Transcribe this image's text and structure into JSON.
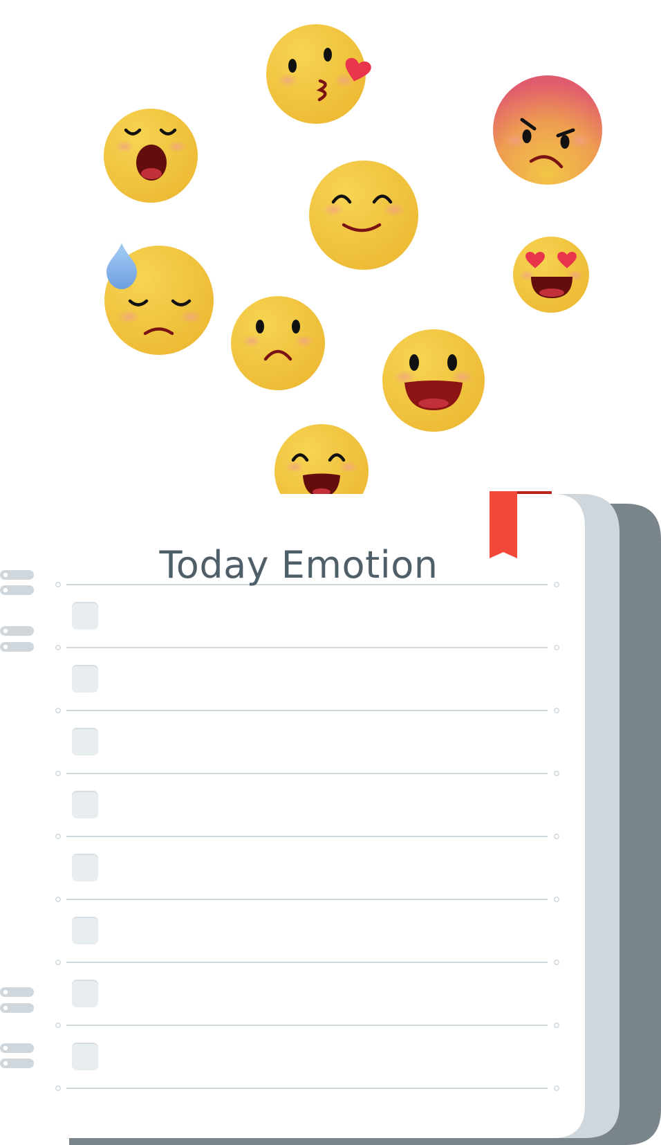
{
  "notebook": {
    "title": "Today Emotion",
    "checkbox_rows": 8,
    "checked": [
      false,
      false,
      false,
      false,
      false,
      false,
      false,
      false
    ]
  },
  "emojis": [
    {
      "name": "kissing-heart"
    },
    {
      "name": "angry"
    },
    {
      "name": "yawning"
    },
    {
      "name": "smiling"
    },
    {
      "name": "heart-eyes"
    },
    {
      "name": "downcast-sweat"
    },
    {
      "name": "frowning"
    },
    {
      "name": "grinning"
    },
    {
      "name": "grinning-squinting"
    }
  ],
  "colors": {
    "emoji_face": "#f3cb47",
    "bookmark": "#f2483a",
    "page": "#ffffff",
    "back_page": "#cfd7dd",
    "cover": "#7a858b",
    "rule_line": "#cfd8dd",
    "checkbox_fill": "#e8edf0",
    "title_text": "#4f5f69"
  }
}
